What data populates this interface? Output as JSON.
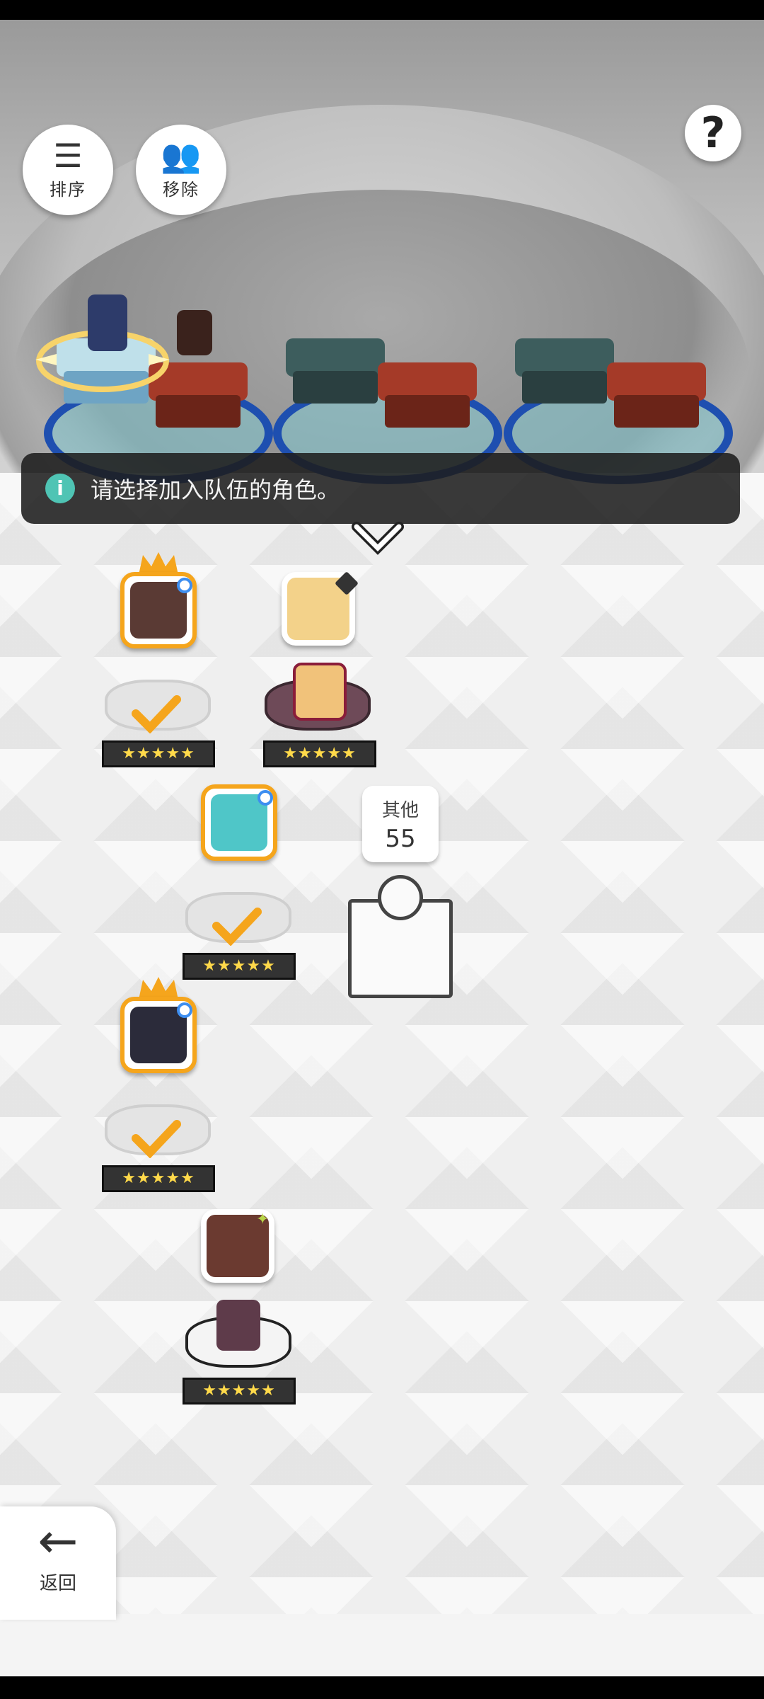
{
  "toolbar": {
    "sort_label": "排序",
    "remove_label": "移除"
  },
  "hint": {
    "text": "请选择加入队伍的角色。"
  },
  "other": {
    "label": "其他",
    "count": "55"
  },
  "roster": [
    {
      "stars": "★★★★★",
      "selected": true,
      "leader": true,
      "face_color": "#5a3a34"
    },
    {
      "stars": "★★★★★",
      "selected": false,
      "leader": false,
      "face_color": "#f3d28a"
    },
    {
      "stars": "★★★★★",
      "selected": true,
      "leader": false,
      "face_color": "#4fc6c8"
    },
    {
      "stars": "★★★★★",
      "selected": true,
      "leader": true,
      "face_color": "#2b2b3a"
    },
    {
      "stars": "★★★★★",
      "selected": false,
      "leader": false,
      "face_color": "#6b3a30"
    }
  ],
  "nav": {
    "back_label": "返回"
  },
  "colors": {
    "accent_orange": "#f5a51c",
    "hint_icon": "#4fc4b4",
    "team_ring": "#1e4fb0"
  }
}
